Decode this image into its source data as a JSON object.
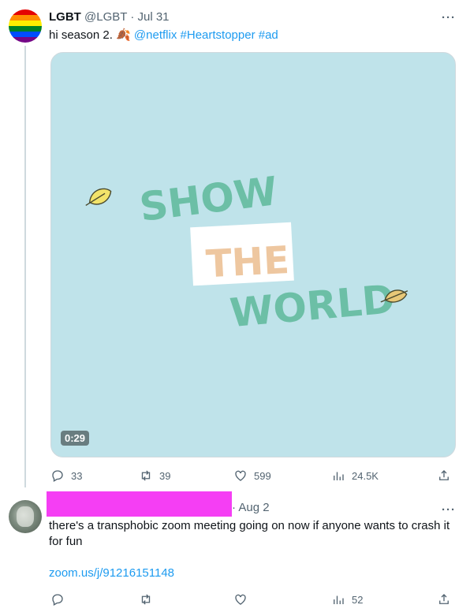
{
  "tweet1": {
    "display_name": "LGBT",
    "handle": "@LGBT",
    "separator": "·",
    "date": "Jul 31",
    "more": "···",
    "text_plain": "hi season 2. ",
    "emoji": "🍂",
    "mention": "@netflix",
    "hashtag1": "#Heartstopper",
    "hashtag2": "#ad",
    "media": {
      "title_line1": "SHOW",
      "title_line2": "THE",
      "title_line3": "WORLD",
      "duration": "0:29"
    },
    "actions": {
      "replies": "33",
      "retweets": "39",
      "likes": "599",
      "views": "24.5K"
    }
  },
  "tweet2": {
    "separator": "·",
    "date": "Aug 2",
    "more": "···",
    "text": "there's a transphobic zoom meeting going on now if anyone wants to crash it for fun",
    "link": "zoom.us/j/91216151148",
    "actions": {
      "views": "52"
    }
  },
  "colors": {
    "link": "#1d9bf0",
    "muted": "#536471",
    "media_bg": "#bfe3ea",
    "title_green": "#6cbfa6",
    "title_peach": "#eec7a0",
    "redaction": "#f53ef4"
  },
  "icons": [
    "reply-icon",
    "retweet-icon",
    "like-icon",
    "views-icon",
    "share-icon",
    "more-icon",
    "leaf-icon"
  ]
}
